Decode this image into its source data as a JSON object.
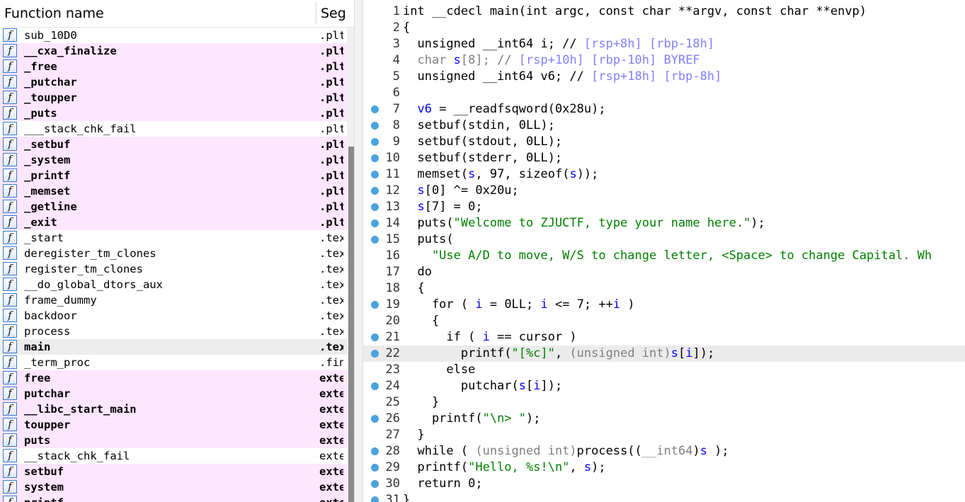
{
  "functions_panel": {
    "col_name": "Function name",
    "col_segment": "Segment",
    "rows": [
      {
        "name": "sub_10D0",
        "seg": ".plt",
        "kind": "normal",
        "bold": false,
        "selected": false
      },
      {
        "name": "__cxa_finalize",
        "seg": ".plt.got",
        "kind": "import",
        "bold": true,
        "selected": false
      },
      {
        "name": "_free",
        "seg": ".plt.sec",
        "kind": "import",
        "bold": true,
        "selected": false
      },
      {
        "name": "_putchar",
        "seg": ".plt.sec",
        "kind": "import",
        "bold": true,
        "selected": false
      },
      {
        "name": "_toupper",
        "seg": ".plt.sec",
        "kind": "import",
        "bold": true,
        "selected": false
      },
      {
        "name": "_puts",
        "seg": ".plt.sec",
        "kind": "import",
        "bold": true,
        "selected": false
      },
      {
        "name": "___stack_chk_fail",
        "seg": ".plt",
        "kind": "normal",
        "bold": false,
        "selected": false
      },
      {
        "name": "_setbuf",
        "seg": ".plt.sec",
        "kind": "import",
        "bold": true,
        "selected": false
      },
      {
        "name": "_system",
        "seg": ".plt.sec",
        "kind": "import",
        "bold": true,
        "selected": false
      },
      {
        "name": "_printf",
        "seg": ".plt.sec",
        "kind": "import",
        "bold": true,
        "selected": false
      },
      {
        "name": "_memset",
        "seg": ".plt.sec",
        "kind": "import",
        "bold": true,
        "selected": false
      },
      {
        "name": "_getline",
        "seg": ".plt.sec",
        "kind": "import",
        "bold": true,
        "selected": false
      },
      {
        "name": "_exit",
        "seg": ".plt.sec",
        "kind": "import",
        "bold": true,
        "selected": false
      },
      {
        "name": "_start",
        "seg": ".text",
        "kind": "normal",
        "bold": false,
        "selected": false
      },
      {
        "name": "deregister_tm_clones",
        "seg": ".text",
        "kind": "normal",
        "bold": false,
        "selected": false
      },
      {
        "name": "register_tm_clones",
        "seg": ".text",
        "kind": "normal",
        "bold": false,
        "selected": false
      },
      {
        "name": "__do_global_dtors_aux",
        "seg": ".text",
        "kind": "normal",
        "bold": false,
        "selected": false
      },
      {
        "name": "frame_dummy",
        "seg": ".text",
        "kind": "normal",
        "bold": false,
        "selected": false
      },
      {
        "name": "backdoor",
        "seg": ".text",
        "kind": "normal",
        "bold": false,
        "selected": false
      },
      {
        "name": "process",
        "seg": ".text",
        "kind": "normal",
        "bold": false,
        "selected": false
      },
      {
        "name": "main",
        "seg": ".text",
        "kind": "normal",
        "bold": true,
        "selected": true
      },
      {
        "name": "_term_proc",
        "seg": ".fini",
        "kind": "normal",
        "bold": false,
        "selected": false
      },
      {
        "name": "free",
        "seg": "extern",
        "kind": "import",
        "bold": true,
        "selected": false
      },
      {
        "name": "putchar",
        "seg": "extern",
        "kind": "import",
        "bold": true,
        "selected": false
      },
      {
        "name": "__libc_start_main",
        "seg": "extern",
        "kind": "import",
        "bold": true,
        "selected": false
      },
      {
        "name": "toupper",
        "seg": "extern",
        "kind": "import",
        "bold": true,
        "selected": false
      },
      {
        "name": "puts",
        "seg": "extern",
        "kind": "import",
        "bold": true,
        "selected": false
      },
      {
        "name": "__stack_chk_fail",
        "seg": "extern",
        "kind": "normal",
        "bold": false,
        "selected": false
      },
      {
        "name": "setbuf",
        "seg": "extern",
        "kind": "import",
        "bold": true,
        "selected": false
      },
      {
        "name": "system",
        "seg": "extern",
        "kind": "import",
        "bold": true,
        "selected": false
      },
      {
        "name": "printf",
        "seg": "extern",
        "kind": "import",
        "bold": true,
        "selected": false
      }
    ]
  },
  "code_panel": {
    "lines": [
      {
        "n": "1",
        "bp": false,
        "cur": false,
        "tokens": [
          [
            "n",
            "int __cdecl main(int argc, const char **argv, const char **envp)"
          ]
        ]
      },
      {
        "n": "2",
        "bp": false,
        "cur": false,
        "tokens": [
          [
            "n",
            "{"
          ]
        ]
      },
      {
        "n": "3",
        "bp": false,
        "cur": false,
        "tokens": [
          [
            "n",
            "  unsigned __int64 i; // "
          ],
          [
            "c",
            "[rsp+8h] [rbp-18h]"
          ]
        ]
      },
      {
        "n": "4",
        "bp": false,
        "cur": false,
        "tokens": [
          [
            "d",
            "  char "
          ],
          [
            "v",
            "s"
          ],
          [
            "d",
            "[8]; // "
          ],
          [
            "c",
            "[rsp+10h] [rbp-10h] BYREF"
          ]
        ]
      },
      {
        "n": "5",
        "bp": false,
        "cur": false,
        "tokens": [
          [
            "n",
            "  unsigned __int64 v6; // "
          ],
          [
            "c",
            "[rsp+18h] [rbp-8h]"
          ]
        ]
      },
      {
        "n": "6",
        "bp": false,
        "cur": false,
        "tokens": []
      },
      {
        "n": "7",
        "bp": true,
        "cur": false,
        "tokens": [
          [
            "v",
            "  v6"
          ],
          [
            "n",
            " = __readfsqword(0x28u);"
          ]
        ]
      },
      {
        "n": "8",
        "bp": true,
        "cur": false,
        "tokens": [
          [
            "n",
            "  setbuf(stdin, 0LL);"
          ]
        ]
      },
      {
        "n": "9",
        "bp": true,
        "cur": false,
        "tokens": [
          [
            "n",
            "  setbuf(stdout, 0LL);"
          ]
        ]
      },
      {
        "n": "10",
        "bp": true,
        "cur": false,
        "tokens": [
          [
            "n",
            "  setbuf(stderr, 0LL);"
          ]
        ]
      },
      {
        "n": "11",
        "bp": true,
        "cur": false,
        "tokens": [
          [
            "n",
            "  memset("
          ],
          [
            "v",
            "s"
          ],
          [
            "n",
            ", 97, sizeof("
          ],
          [
            "v",
            "s"
          ],
          [
            "n",
            "));"
          ]
        ]
      },
      {
        "n": "12",
        "bp": true,
        "cur": false,
        "tokens": [
          [
            "v",
            "  s"
          ],
          [
            "n",
            "[0] ^= 0x20u;"
          ]
        ]
      },
      {
        "n": "13",
        "bp": true,
        "cur": false,
        "tokens": [
          [
            "v",
            "  s"
          ],
          [
            "n",
            "[7] = 0;"
          ]
        ]
      },
      {
        "n": "14",
        "bp": true,
        "cur": false,
        "tokens": [
          [
            "n",
            "  puts("
          ],
          [
            "s",
            "\"Welcome to ZJUCTF, type your name here.\""
          ],
          [
            "n",
            ");"
          ]
        ]
      },
      {
        "n": "15",
        "bp": true,
        "cur": false,
        "tokens": [
          [
            "n",
            "  puts("
          ]
        ]
      },
      {
        "n": "16",
        "bp": false,
        "cur": false,
        "tokens": [
          [
            "s",
            "    \"Use A/D to move, W/S to change letter, <Space> to change Capital. Wh"
          ]
        ]
      },
      {
        "n": "17",
        "bp": false,
        "cur": false,
        "tokens": [
          [
            "n",
            "  do"
          ]
        ]
      },
      {
        "n": "18",
        "bp": false,
        "cur": false,
        "tokens": [
          [
            "n",
            "  {"
          ]
        ]
      },
      {
        "n": "19",
        "bp": true,
        "cur": false,
        "tokens": [
          [
            "n",
            "    for ( "
          ],
          [
            "v",
            "i"
          ],
          [
            "n",
            " = 0LL; "
          ],
          [
            "v",
            "i"
          ],
          [
            "n",
            " <= 7; ++"
          ],
          [
            "v",
            "i"
          ],
          [
            "n",
            " )"
          ]
        ]
      },
      {
        "n": "20",
        "bp": false,
        "cur": false,
        "tokens": [
          [
            "n",
            "    {"
          ]
        ]
      },
      {
        "n": "21",
        "bp": true,
        "cur": false,
        "tokens": [
          [
            "n",
            "      if ( "
          ],
          [
            "v",
            "i"
          ],
          [
            "n",
            " == cursor )"
          ]
        ]
      },
      {
        "n": "22",
        "bp": true,
        "cur": true,
        "tokens": [
          [
            "n",
            "        printf("
          ],
          [
            "s",
            "\"[%c]\""
          ],
          [
            "n",
            ", "
          ],
          [
            "d",
            "(unsigned int)"
          ],
          [
            "v",
            "s"
          ],
          [
            "n",
            "["
          ],
          [
            "v",
            "i"
          ],
          [
            "n",
            "]);"
          ]
        ]
      },
      {
        "n": "23",
        "bp": false,
        "cur": false,
        "tokens": [
          [
            "n",
            "      else"
          ]
        ]
      },
      {
        "n": "24",
        "bp": true,
        "cur": false,
        "tokens": [
          [
            "n",
            "        putchar("
          ],
          [
            "v",
            "s"
          ],
          [
            "n",
            "["
          ],
          [
            "v",
            "i"
          ],
          [
            "n",
            "]);"
          ]
        ]
      },
      {
        "n": "25",
        "bp": false,
        "cur": false,
        "tokens": [
          [
            "n",
            "    }"
          ]
        ]
      },
      {
        "n": "26",
        "bp": true,
        "cur": false,
        "tokens": [
          [
            "n",
            "    printf("
          ],
          [
            "s",
            "\"\\n> \""
          ],
          [
            "n",
            ");"
          ]
        ]
      },
      {
        "n": "27",
        "bp": false,
        "cur": false,
        "tokens": [
          [
            "n",
            "  }"
          ]
        ]
      },
      {
        "n": "28",
        "bp": true,
        "cur": false,
        "tokens": [
          [
            "n",
            "  while ( "
          ],
          [
            "d",
            "(unsigned int)"
          ],
          [
            "n",
            "process(("
          ],
          [
            "d",
            "__int64"
          ],
          [
            "n",
            ")"
          ],
          [
            "v",
            "s"
          ],
          [
            "n",
            " );"
          ]
        ]
      },
      {
        "n": "29",
        "bp": true,
        "cur": false,
        "tokens": [
          [
            "n",
            "  printf("
          ],
          [
            "s",
            "\"Hello, %s!\\n\""
          ],
          [
            "n",
            ", "
          ],
          [
            "v",
            "s"
          ],
          [
            "n",
            ");"
          ]
        ]
      },
      {
        "n": "30",
        "bp": true,
        "cur": false,
        "tokens": [
          [
            "n",
            "  return 0;"
          ]
        ]
      },
      {
        "n": "31",
        "bp": true,
        "cur": false,
        "tokens": [
          [
            "n",
            "}"
          ]
        ]
      }
    ]
  }
}
